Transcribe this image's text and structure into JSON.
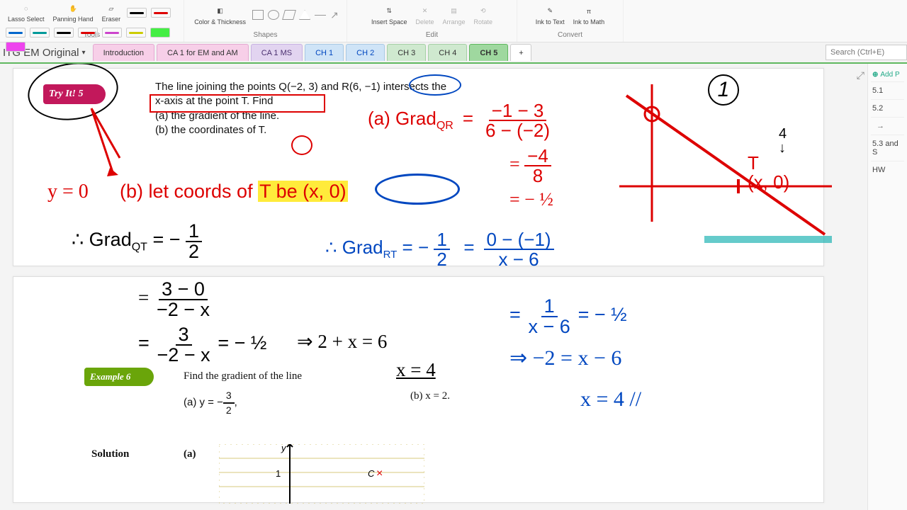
{
  "ribbon": {
    "tools": {
      "lasso": "Lasso Select",
      "pan": "Panning Hand",
      "eraser": "Eraser",
      "color": "Color & Thickness",
      "label": "Tools"
    },
    "shapes": {
      "label": "Shapes"
    },
    "edit": {
      "insert_space": "Insert Space",
      "delete": "Delete",
      "arrange": "Arrange",
      "rotate": "Rotate",
      "label": "Edit"
    },
    "convert": {
      "ink_text": "Ink to Text",
      "ink_math": "Ink to Math",
      "label": "Convert"
    }
  },
  "notebook_title": "ITG EM Original",
  "tabs": [
    "Introduction",
    "CA 1 for EM and AM",
    "CA 1 MS",
    "CH 1",
    "CH 2",
    "CH 3",
    "CH 4",
    "CH 5"
  ],
  "active_tab": "CH 5",
  "search_placeholder": "Search (Ctrl+E)",
  "add_tab": "+",
  "side": {
    "add": "Add P",
    "pages": [
      "5.1",
      "5.2",
      "→",
      "5.3 and S",
      "HW"
    ]
  },
  "textbook": {
    "try_label": "Try It!  5",
    "q_line1": "The line joining the points Q(−2, 3) and R(6, −1) intersects the",
    "q_line2": "x-axis at the point T. Find",
    "q_a": "(a)    the gradient of the line.",
    "q_b": "(b)    the coordinates of T.",
    "ex_label": "Example 6",
    "ex_prompt": "Find the gradient of the line",
    "ex_a": "(a)   y = −",
    "ex_a_frac_n": "3",
    "ex_a_frac_d": "2",
    "ex_a_tail": ",",
    "ex_b": "(b)    x = 2.",
    "solution": "Solution",
    "sol_a": "(a)"
  },
  "hand": {
    "yzero": "y = 0",
    "a_label": "(a)  Grad",
    "a_sub": "QR",
    "a_eq": "=",
    "a_frac1_n": "−1 − 3",
    "a_frac1_d": "6 − (−2)",
    "a_frac2_n": "−4",
    "a_frac2_d": "8",
    "a_half": "= − ½",
    "b_label": "(b)  let coords of ",
    "b_t": "T be (x, 0)",
    "gradqt": "∴  Grad",
    "gradqt_sub": "QT",
    "gradqt_eq": " =  − ",
    "gradqt_n": "1",
    "gradqt_d": "2",
    "gradrt": "∴  Grad",
    "gradrt_sub": "RT",
    "gradrt_eq": " = − ",
    "gradrt_n": "1",
    "gradrt_d": "2",
    "rt_eq2": "=",
    "rt_frac_n": "0 − (−1)",
    "rt_frac_d": "x − 6",
    "qt_frac_n": "3 − 0",
    "qt_frac_d": "−2 − x",
    "qt_line2a": "=",
    "qt_line2_n": "3",
    "qt_line2_d": "−2 − x",
    "qt_line2b": " = − ½",
    "qt_imp": "⇒ 2 + x = 6",
    "rt_line2": "=",
    "rt_line2_n": "1",
    "rt_line2_d": "x − 6",
    "rt_line2b": " = − ½",
    "rt_imp": "⇒   −2 = x − 6",
    "x4a": "x = 4",
    "x4b": "x = 4  //",
    "T_label": "T",
    "T_coord": "(x, 0)",
    "four": "4",
    "circ1": "1"
  }
}
